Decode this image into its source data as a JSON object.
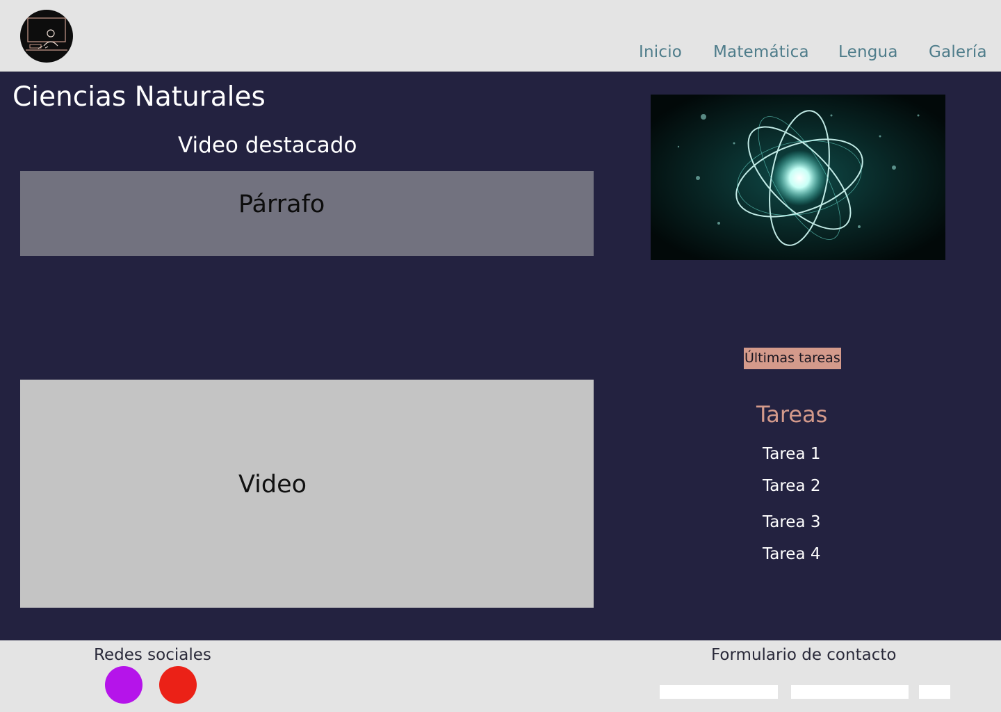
{
  "header": {
    "logo_icon": "teacher-at-chalkboard-icon",
    "nav": [
      {
        "label": "Inicio"
      },
      {
        "label": "Matemática"
      },
      {
        "label": "Lengua"
      },
      {
        "label": "Galería"
      }
    ]
  },
  "main": {
    "title": "Ciencias Naturales",
    "featured_video_title": "Video destacado",
    "paragraph_placeholder": "Párrafo",
    "video_placeholder": "Video",
    "hero_image_icon": "glowing-atom-image"
  },
  "sidebar": {
    "badge": "Últimas tareas",
    "heading": "Tareas",
    "tasks": [
      "Tarea 1",
      "Tarea 2",
      "Tarea 3",
      "Tarea 4"
    ]
  },
  "footer": {
    "social_title": "Redes sociales",
    "social": [
      {
        "icon": "purple-circle",
        "color": "#b514ea"
      },
      {
        "icon": "red-circle",
        "color": "#eb2117"
      }
    ],
    "contact_title": "Formulario de contacto"
  },
  "colors": {
    "background": "#232240",
    "header_bg": "#e4e4e4",
    "nav_text": "#4e7c8a",
    "accent": "#d49a8b",
    "paragraph_box": "#72727f",
    "video_box": "#c4c4c4"
  }
}
